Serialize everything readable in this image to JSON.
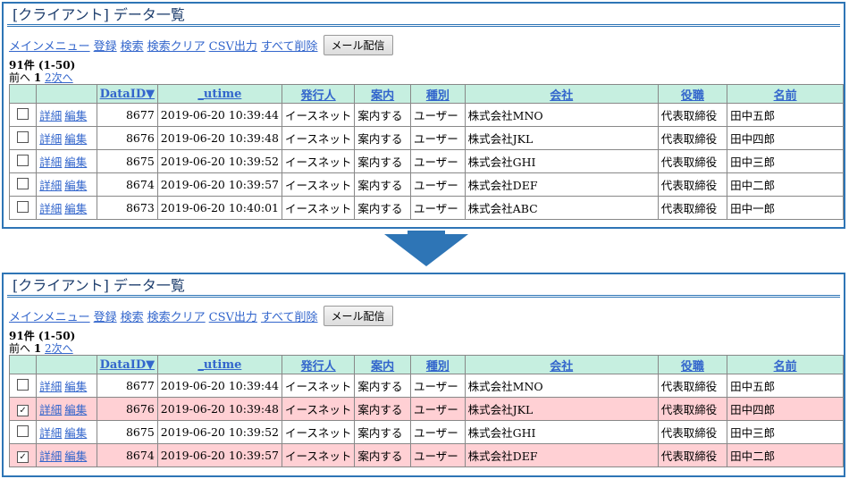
{
  "title": "[クライアント] データ一覧",
  "menu": [
    "メインメニュー",
    "登録",
    "検索",
    "検索クリア",
    "CSV出力",
    "すべて削除"
  ],
  "mail_button": "メール配信",
  "count": "91件 (1-50)",
  "pager": {
    "prev": "前へ",
    "current": "1",
    "page2": "2",
    "next": "次へ"
  },
  "columns": [
    "DataID▼",
    "_utime",
    "発行人",
    "案内",
    "種別",
    "会社",
    "役職",
    "名前"
  ],
  "links": {
    "detail": "詳細",
    "edit": "編集"
  },
  "check_mark": "✓",
  "before_rows": [
    {
      "id": "8677",
      "utime": "2019-06-20 10:39:44",
      "issuer": "イースネット",
      "guide": "案内する",
      "type": "ユーザー",
      "company": "株式会社MNO",
      "role": "代表取締役",
      "name": "田中五郎",
      "checked": false
    },
    {
      "id": "8676",
      "utime": "2019-06-20 10:39:48",
      "issuer": "イースネット",
      "guide": "案内する",
      "type": "ユーザー",
      "company": "株式会社JKL",
      "role": "代表取締役",
      "name": "田中四郎",
      "checked": false
    },
    {
      "id": "8675",
      "utime": "2019-06-20 10:39:52",
      "issuer": "イースネット",
      "guide": "案内する",
      "type": "ユーザー",
      "company": "株式会社GHI",
      "role": "代表取締役",
      "name": "田中三郎",
      "checked": false
    },
    {
      "id": "8674",
      "utime": "2019-06-20 10:39:57",
      "issuer": "イースネット",
      "guide": "案内する",
      "type": "ユーザー",
      "company": "株式会社DEF",
      "role": "代表取締役",
      "name": "田中二郎",
      "checked": false
    },
    {
      "id": "8673",
      "utime": "2019-06-20 10:40:01",
      "issuer": "イースネット",
      "guide": "案内する",
      "type": "ユーザー",
      "company": "株式会社ABC",
      "role": "代表取締役",
      "name": "田中一郎",
      "checked": false
    }
  ],
  "after_rows": [
    {
      "id": "8677",
      "utime": "2019-06-20 10:39:44",
      "issuer": "イースネット",
      "guide": "案内する",
      "type": "ユーザー",
      "company": "株式会社MNO",
      "role": "代表取締役",
      "name": "田中五郎",
      "checked": false
    },
    {
      "id": "8676",
      "utime": "2019-06-20 10:39:48",
      "issuer": "イースネット",
      "guide": "案内する",
      "type": "ユーザー",
      "company": "株式会社JKL",
      "role": "代表取締役",
      "name": "田中四郎",
      "checked": true
    },
    {
      "id": "8675",
      "utime": "2019-06-20 10:39:52",
      "issuer": "イースネット",
      "guide": "案内する",
      "type": "ユーザー",
      "company": "株式会社GHI",
      "role": "代表取締役",
      "name": "田中三郎",
      "checked": false
    },
    {
      "id": "8674",
      "utime": "2019-06-20 10:39:57",
      "issuer": "イースネット",
      "guide": "案内する",
      "type": "ユーザー",
      "company": "株式会社DEF",
      "role": "代表取締役",
      "name": "田中二郎",
      "checked": true
    }
  ],
  "colors": {
    "frame": "#2e75b6",
    "header_bg": "#c6efe0",
    "selected_bg": "#ffd0d4",
    "link": "#3366cc"
  }
}
